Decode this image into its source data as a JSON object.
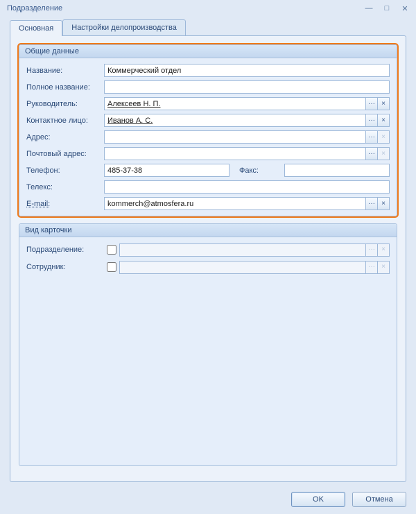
{
  "window": {
    "title": "Подразделение"
  },
  "tabs": {
    "main": "Основная",
    "settings": "Настройки делопроизводства"
  },
  "groups": {
    "general": "Общие данные",
    "card": "Вид карточки"
  },
  "labels": {
    "name": "Название:",
    "fullname": "Полное название:",
    "head": "Руководитель:",
    "contact": "Контактное лицо:",
    "address": "Адрес:",
    "post": "Почтовый адрес:",
    "phone": "Телефон:",
    "fax": "Факс:",
    "telex": "Телекс:",
    "email": "E-mail:",
    "dept": "Подразделение:",
    "employee": "Сотрудник:"
  },
  "values": {
    "name": "Коммерческий отдел",
    "fullname": "",
    "head": "Алексеев Н. П.",
    "contact": "Иванов А. С.",
    "address": "",
    "post": "",
    "phone": "485-37-38",
    "fax": "",
    "telex": "",
    "email": "kommerch@atmosfera.ru",
    "dept": "",
    "employee": ""
  },
  "icons": {
    "ellipsis": "···",
    "clear": "×",
    "min": "—",
    "max": "□",
    "close": "✕"
  },
  "buttons": {
    "ok": "OK",
    "cancel": "Отмена"
  }
}
